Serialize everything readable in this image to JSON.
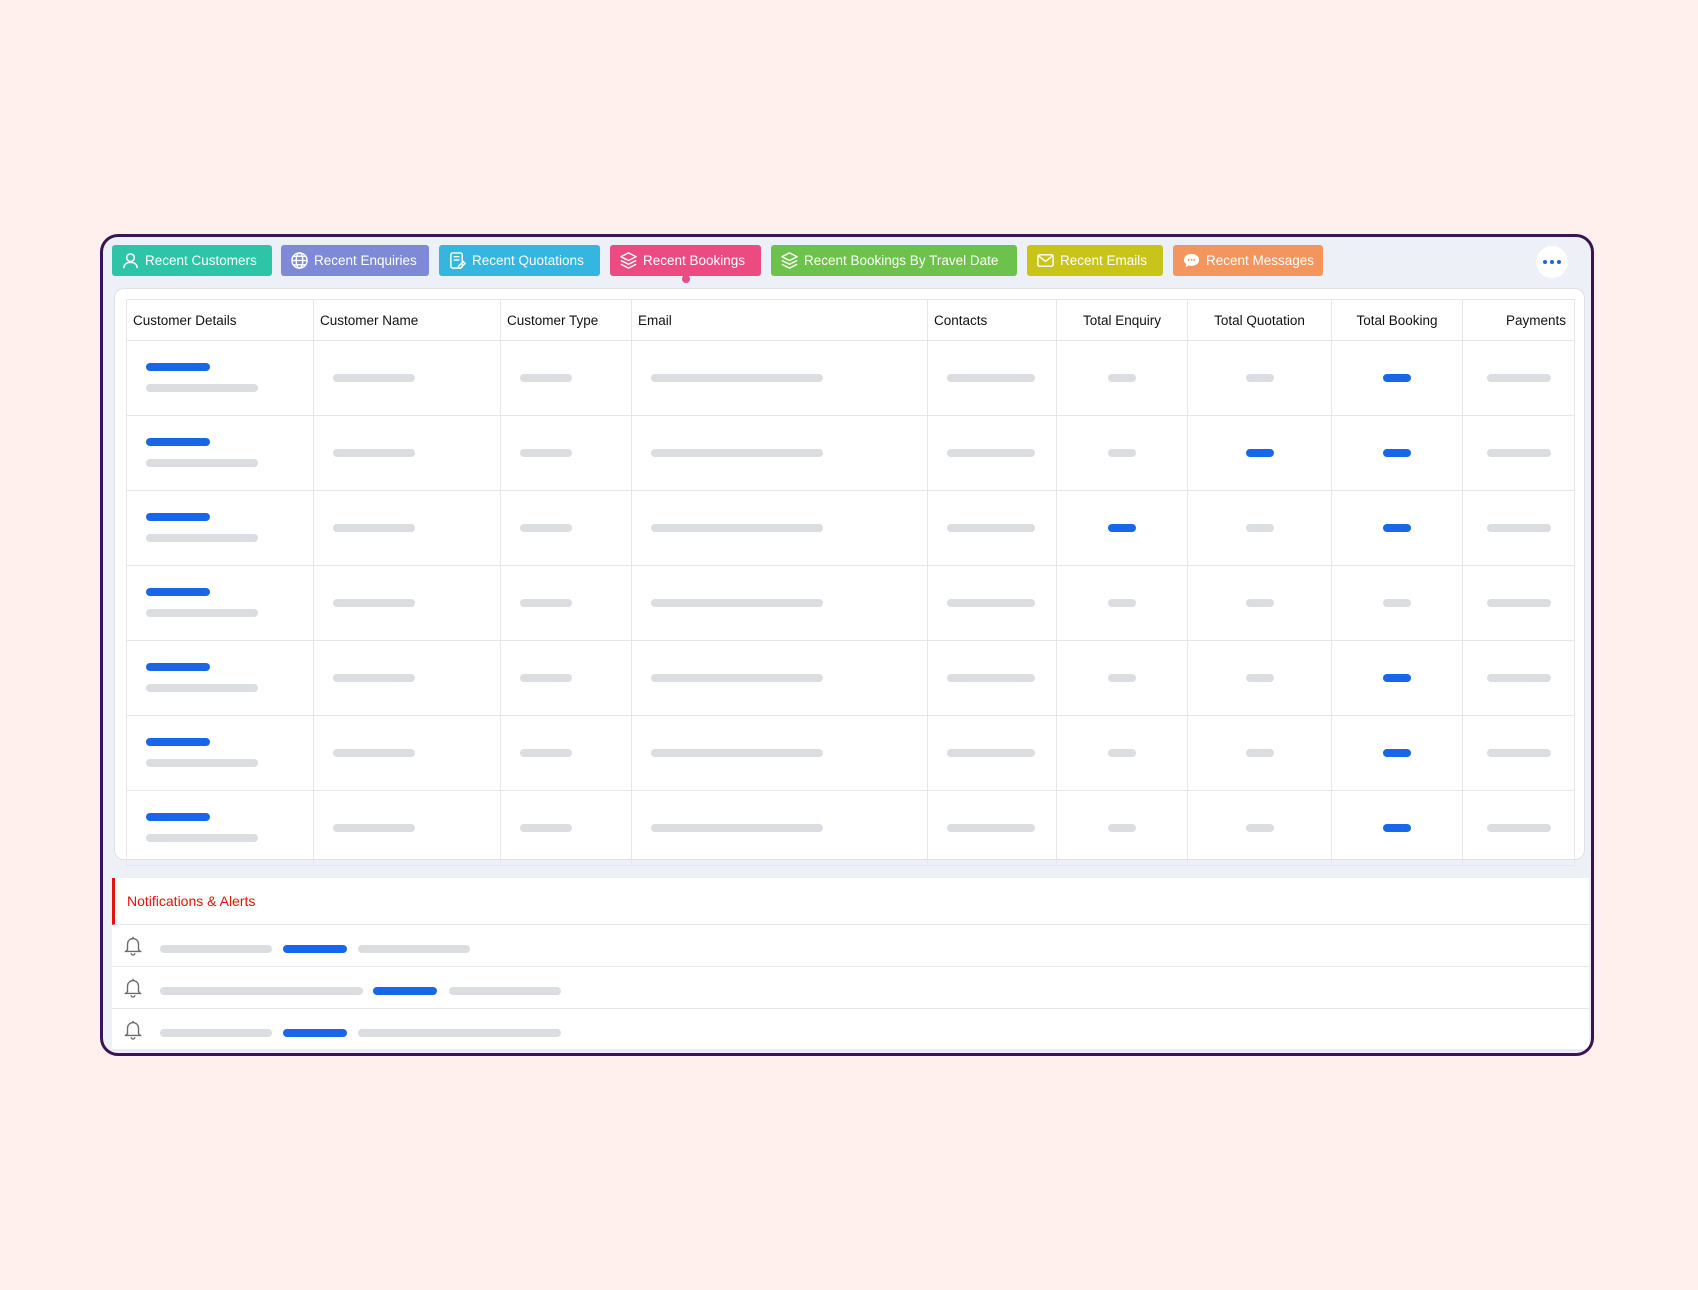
{
  "tabs": [
    {
      "label": "Recent Customers",
      "icon": "user-icon",
      "color": "#2ec4a8"
    },
    {
      "label": "Recent Enquiries",
      "icon": "globe-icon",
      "color": "#7f8ad6"
    },
    {
      "label": "Recent Quotations",
      "icon": "quote-doc-icon",
      "color": "#35b6e0"
    },
    {
      "label": "Recent Bookings",
      "icon": "layers-icon",
      "color": "#ec4b82"
    },
    {
      "label": "Recent Bookings By Travel Date",
      "icon": "layers-icon",
      "color": "#6cc24a"
    },
    {
      "label": "Recent Emails",
      "icon": "envelope-icon",
      "color": "#c8c41a"
    },
    {
      "label": "Recent Messages",
      "icon": "chat-icon",
      "color": "#f4955e"
    }
  ],
  "active_tab": "Recent Bookings",
  "more_icon": "more-dots-icon",
  "table": {
    "headers": [
      "Customer Details",
      "Customer Name",
      "Customer Type",
      "Email",
      "Contacts",
      "Total Enquiry",
      "Total Quotation",
      "Total Booking",
      "Payments"
    ],
    "rows": [
      {
        "enquiry_highlight": false,
        "quotation_highlight": false,
        "booking_highlight": true
      },
      {
        "enquiry_highlight": false,
        "quotation_highlight": true,
        "booking_highlight": true
      },
      {
        "enquiry_highlight": true,
        "quotation_highlight": false,
        "booking_highlight": true
      },
      {
        "enquiry_highlight": false,
        "quotation_highlight": false,
        "booking_highlight": false
      },
      {
        "enquiry_highlight": false,
        "quotation_highlight": false,
        "booking_highlight": true
      },
      {
        "enquiry_highlight": false,
        "quotation_highlight": false,
        "booking_highlight": true
      },
      {
        "enquiry_highlight": false,
        "quotation_highlight": false,
        "booking_highlight": true
      }
    ]
  },
  "notifications": {
    "title": "Notifications & Alerts",
    "icon": "bell-icon",
    "items_count": 3
  },
  "colors": {
    "accent": "#1a66e8",
    "alert": "#e3120b",
    "frame": "#3a1352"
  }
}
